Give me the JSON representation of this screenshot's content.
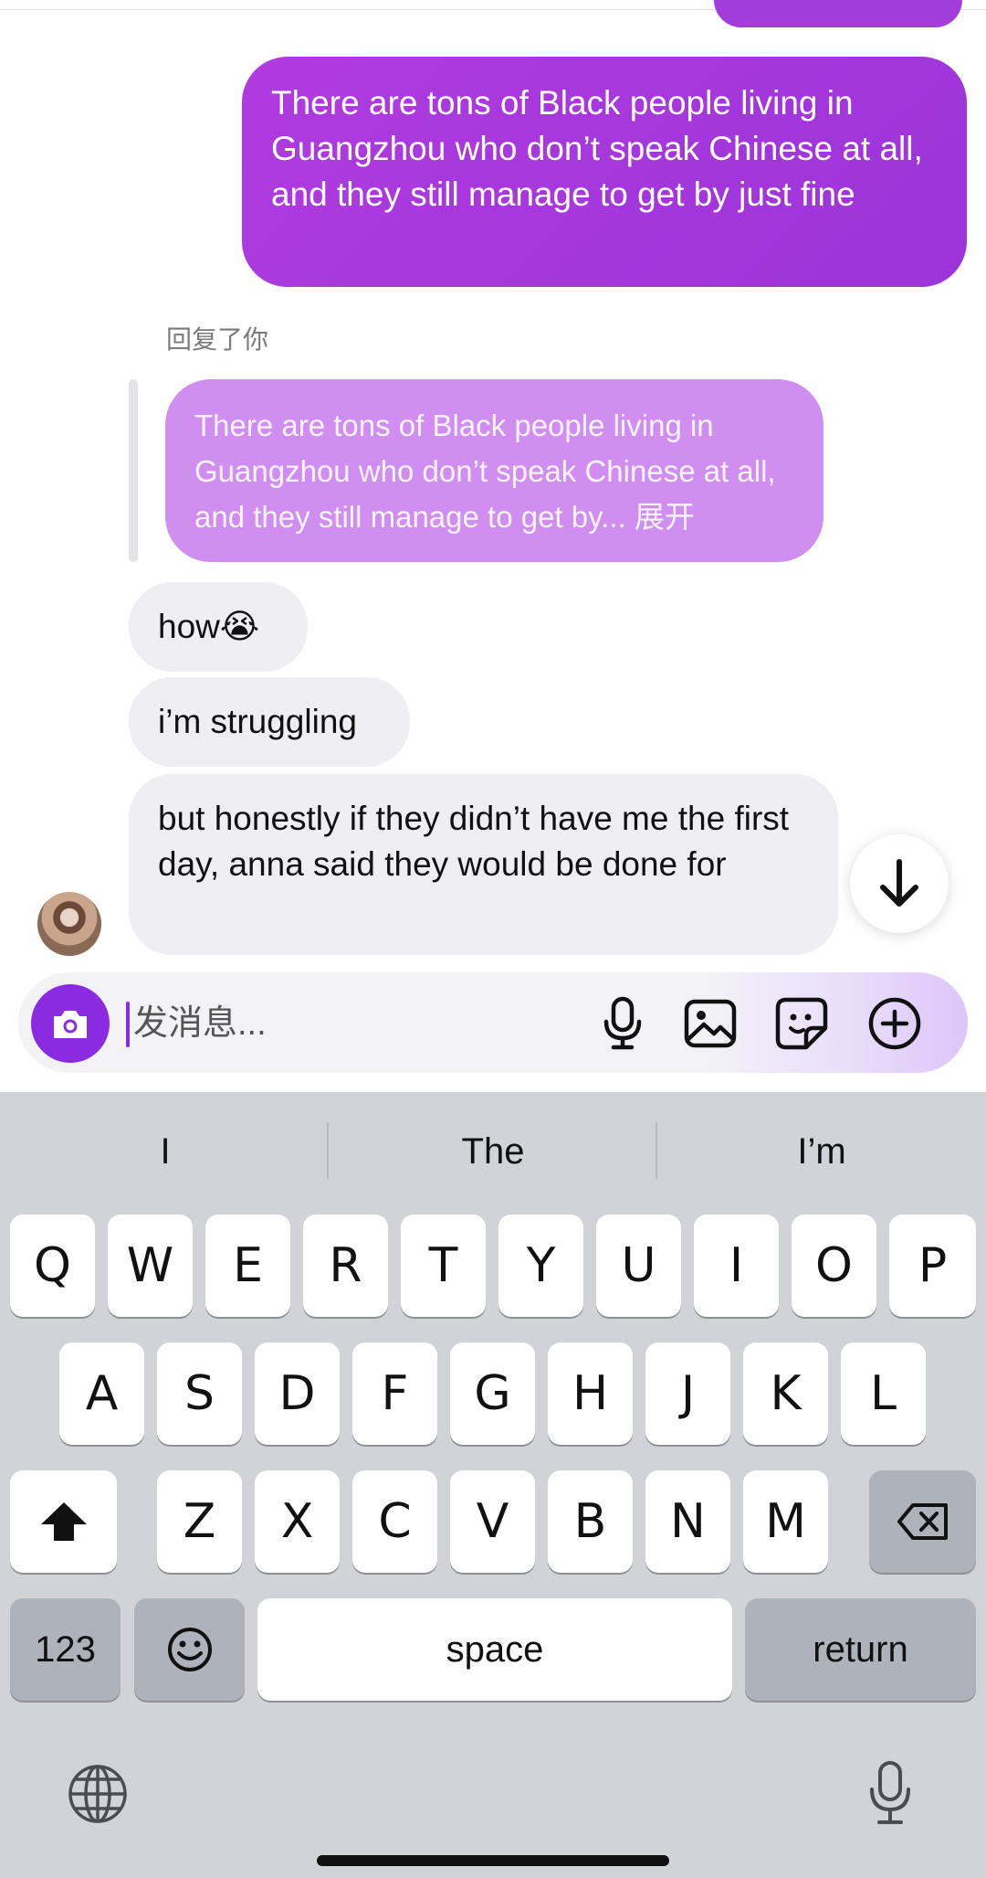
{
  "chat": {
    "sent_message": "There are tons of Black people living in Guangzhou who don’t speak Chinese at all, and they still manage to get by just fine",
    "reply_label": "回复了你",
    "quoted_message": "There are tons of Black people living in Guangzhou who don’t speak Chinese at all, and they still manage to get by... 展开",
    "received": [
      "how😭",
      "i’m struggling",
      "but honestly if they didn’t have me the first day, anna said they would be done for"
    ]
  },
  "composer": {
    "placeholder": "发消息..."
  },
  "keyboard": {
    "suggestions": [
      "I",
      "The",
      "I’m"
    ],
    "row1": [
      "Q",
      "W",
      "E",
      "R",
      "T",
      "Y",
      "U",
      "I",
      "O",
      "P"
    ],
    "row2": [
      "A",
      "S",
      "D",
      "F",
      "G",
      "H",
      "J",
      "K",
      "L"
    ],
    "row3": [
      "Z",
      "X",
      "C",
      "V",
      "B",
      "N",
      "M"
    ],
    "numbers_label": "123",
    "space_label": "space",
    "return_label": "return"
  },
  "colors": {
    "sent_bubble": "#a23ddc",
    "quoted_bubble": "#cf8ef0",
    "received_bubble": "#eeeef3",
    "accent": "#8a2be2",
    "keyboard_bg": "#d1d3d9"
  },
  "icons": {
    "scroll": "arrow-down-icon",
    "camera": "camera-icon",
    "mic": "microphone-icon",
    "image": "image-icon",
    "sticker": "sticker-icon",
    "add": "plus-circle-icon",
    "shift": "shift-icon",
    "backspace": "backspace-icon",
    "emoji": "emoji-icon",
    "globe": "globe-icon"
  }
}
